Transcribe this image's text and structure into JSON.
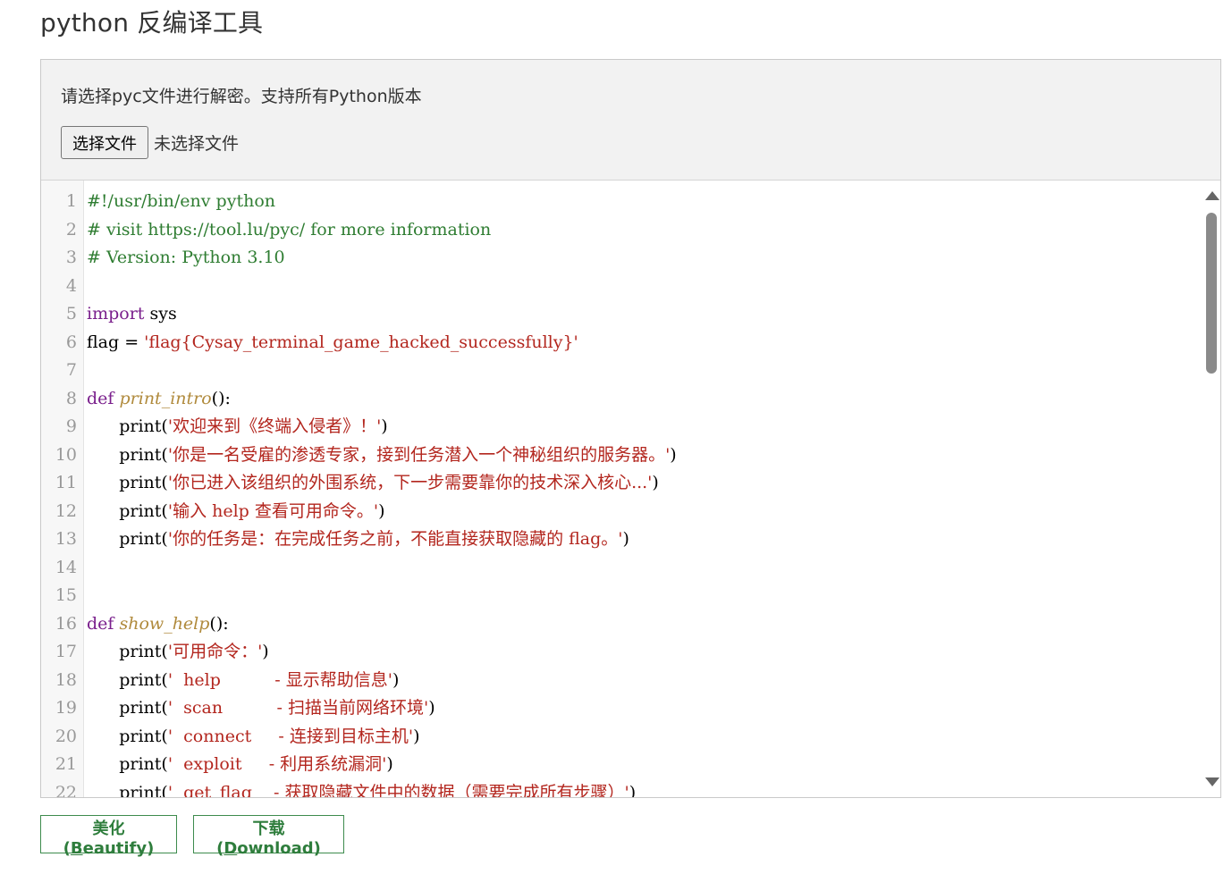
{
  "page": {
    "title": "python 反编译工具"
  },
  "upload": {
    "hint": "请选择pyc文件进行解密。支持所有Python版本",
    "choose_button": "选择文件",
    "status": "未选择文件"
  },
  "code_lines": [
    {
      "n": "1",
      "segs": [
        [
          "cm",
          "#!/usr/bin/env python"
        ]
      ]
    },
    {
      "n": "2",
      "segs": [
        [
          "cm",
          "# visit https://tool.lu/pyc/ for more information"
        ]
      ]
    },
    {
      "n": "3",
      "segs": [
        [
          "cm",
          "# Version: Python 3.10"
        ]
      ]
    },
    {
      "n": "4",
      "segs": []
    },
    {
      "n": "5",
      "segs": [
        [
          "kw",
          "import"
        ],
        [
          "pl",
          " sys"
        ]
      ]
    },
    {
      "n": "6",
      "segs": [
        [
          "pl",
          "flag = "
        ],
        [
          "st",
          "'flag{Cysay_terminal_game_hacked_successfully}'"
        ]
      ]
    },
    {
      "n": "7",
      "segs": []
    },
    {
      "n": "8",
      "segs": [
        [
          "kw",
          "def"
        ],
        [
          "pl",
          " "
        ],
        [
          "fn",
          "print_intro"
        ],
        [
          "pl",
          "():"
        ]
      ]
    },
    {
      "n": "9",
      "segs": [
        [
          "pl",
          "      print("
        ],
        [
          "st",
          "'欢迎来到《终端入侵者》！'"
        ],
        [
          "pl",
          ")"
        ]
      ]
    },
    {
      "n": "10",
      "segs": [
        [
          "pl",
          "      print("
        ],
        [
          "st",
          "'你是一名受雇的渗透专家，接到任务潜入一个神秘组织的服务器。'"
        ],
        [
          "pl",
          ")"
        ]
      ]
    },
    {
      "n": "11",
      "segs": [
        [
          "pl",
          "      print("
        ],
        [
          "st",
          "'你已进入该组织的外围系统，下一步需要靠你的技术深入核心...'"
        ],
        [
          "pl",
          ")"
        ]
      ]
    },
    {
      "n": "12",
      "segs": [
        [
          "pl",
          "      print("
        ],
        [
          "st",
          "'输入 help 查看可用命令。'"
        ],
        [
          "pl",
          ")"
        ]
      ]
    },
    {
      "n": "13",
      "segs": [
        [
          "pl",
          "      print("
        ],
        [
          "st",
          "'你的任务是：在完成任务之前，不能直接获取隐藏的 flag。'"
        ],
        [
          "pl",
          ")"
        ]
      ]
    },
    {
      "n": "14",
      "segs": []
    },
    {
      "n": "15",
      "segs": []
    },
    {
      "n": "16",
      "segs": [
        [
          "kw",
          "def"
        ],
        [
          "pl",
          " "
        ],
        [
          "fn",
          "show_help"
        ],
        [
          "pl",
          "():"
        ]
      ]
    },
    {
      "n": "17",
      "segs": [
        [
          "pl",
          "      print("
        ],
        [
          "st",
          "'可用命令：'"
        ],
        [
          "pl",
          ")"
        ]
      ]
    },
    {
      "n": "18",
      "segs": [
        [
          "pl",
          "      print("
        ],
        [
          "st",
          "'  help          - 显示帮助信息'"
        ],
        [
          "pl",
          ")"
        ]
      ]
    },
    {
      "n": "19",
      "segs": [
        [
          "pl",
          "      print("
        ],
        [
          "st",
          "'  scan          - 扫描当前网络环境'"
        ],
        [
          "pl",
          ")"
        ]
      ]
    },
    {
      "n": "20",
      "segs": [
        [
          "pl",
          "      print("
        ],
        [
          "st",
          "'  connect     - 连接到目标主机'"
        ],
        [
          "pl",
          ")"
        ]
      ]
    },
    {
      "n": "21",
      "segs": [
        [
          "pl",
          "      print("
        ],
        [
          "st",
          "'  exploit     - 利用系统漏洞'"
        ],
        [
          "pl",
          ")"
        ]
      ]
    },
    {
      "n": "22",
      "segs": [
        [
          "pl",
          "      print("
        ],
        [
          "st",
          "'  get_flag    - 获取隐藏文件中的数据（需要完成所有步骤）'"
        ],
        [
          "pl",
          ")"
        ]
      ]
    }
  ],
  "actions": {
    "beautify_prefix": "美化(",
    "beautify_key": "B",
    "beautify_rest": "eautify)",
    "download_prefix": "下载(",
    "download_key": "D",
    "download_rest": "ownload)"
  },
  "colors": {
    "comment": "#2f7d32",
    "keyword": "#7a1f8c",
    "function": "#b08a3c",
    "string": "#b3261e",
    "button_green": "#2e7d3c"
  },
  "icons": {
    "scroll_up": "triangle-up",
    "scroll_down": "triangle-down"
  }
}
